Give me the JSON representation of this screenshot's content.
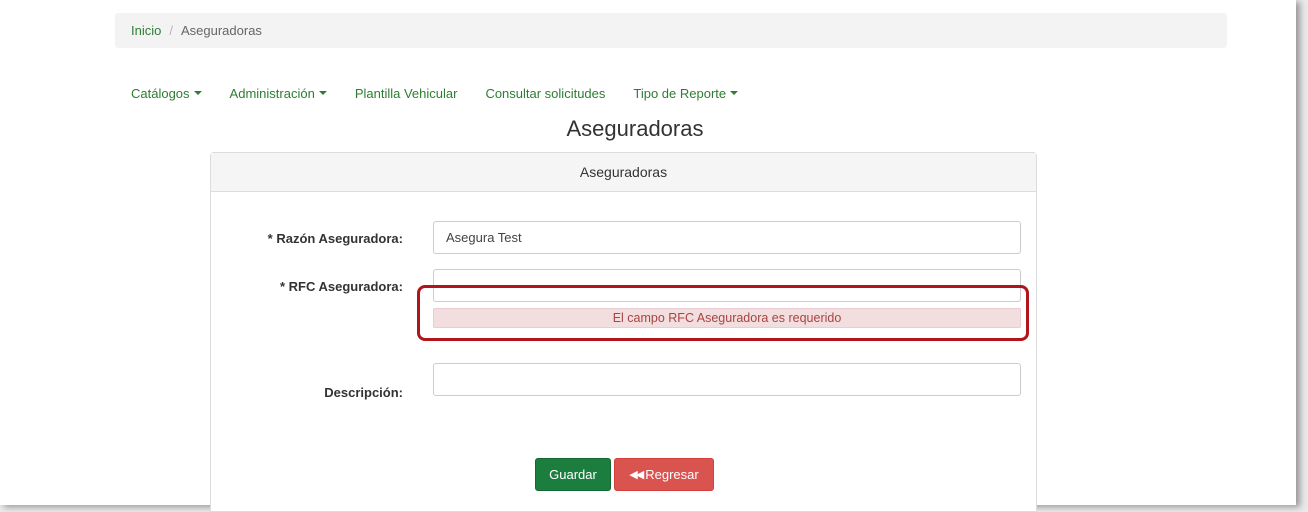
{
  "breadcrumb": {
    "home_label": "Inicio",
    "separator": "/",
    "current_label": "Aseguradoras"
  },
  "nav": {
    "catalogos": "Catálogos",
    "administracion": "Administración",
    "plantilla": "Plantilla Vehicular",
    "consultar": "Consultar solicitudes",
    "tipo_reporte": "Tipo de Reporte"
  },
  "page_title": "Aseguradoras",
  "panel": {
    "heading": "Aseguradoras"
  },
  "form": {
    "razon_label": "* Razón Aseguradora:",
    "razon_value": "Asegura Test",
    "rfc_label": "* RFC Aseguradora:",
    "rfc_value": "",
    "rfc_error": "El campo RFC Aseguradora es requerido",
    "descripcion_label": "Descripción:",
    "descripcion_value": ""
  },
  "buttons": {
    "save_label": "Guardar",
    "back_label": "Regresar",
    "back_icon": "double-chevron-left-icon"
  },
  "colors": {
    "nav_link": "#2e7d32",
    "save_button": "#1b7e3f",
    "back_button": "#d9534f",
    "error_bg": "#f2dede",
    "error_text": "#a94442",
    "highlight_border": "#b0151b"
  }
}
